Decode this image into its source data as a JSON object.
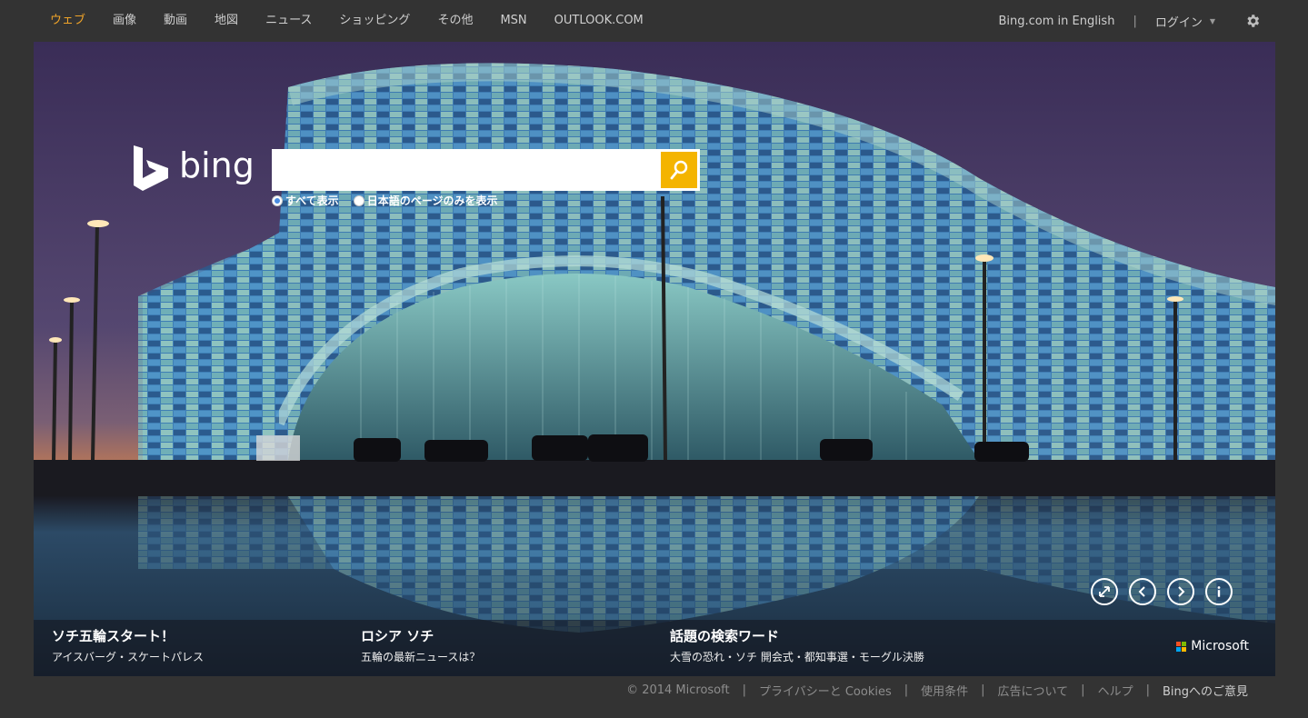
{
  "nav": {
    "items": [
      "ウェブ",
      "画像",
      "動画",
      "地図",
      "ニュース",
      "ショッピング",
      "その他",
      "MSN",
      "OUTLOOK.COM"
    ],
    "active_index": 0,
    "english_link": "Bing.com in English",
    "separator": "|",
    "login": "ログイン",
    "caret": "▼"
  },
  "logo": {
    "word": "bing"
  },
  "search": {
    "value": "",
    "placeholder": "",
    "options": [
      "すべて表示",
      "日本語のページのみを表示"
    ],
    "selected_index": 0
  },
  "cards": [
    {
      "title": "ソチ五輪スタート！",
      "subtitle": "アイスバーグ・スケートパレス"
    },
    {
      "title": "ロシア ソチ",
      "subtitle": "五輪の最新ニュースは？"
    },
    {
      "title": "話題の検索ワード",
      "subtitle": "大雪の恐れ・ソチ 開会式・都知事選・モーグル決勝"
    }
  ],
  "brand": "Microsoft",
  "brand_colors": [
    "#f25022",
    "#7fba00",
    "#00a4ef",
    "#ffb900"
  ],
  "accent": "#f4b400",
  "active_nav_color": "#f0a429",
  "icons": [
    "gear-icon",
    "search-icon",
    "expand-icon",
    "previous-icon",
    "next-icon",
    "info-icon",
    "bing-logo-icon"
  ],
  "footer": {
    "items": [
      "© 2014 Microsoft",
      "プライバシーと Cookies",
      "使用条件",
      "広告について",
      "ヘルプ",
      "Bingへのご意見"
    ],
    "separator": "|"
  }
}
